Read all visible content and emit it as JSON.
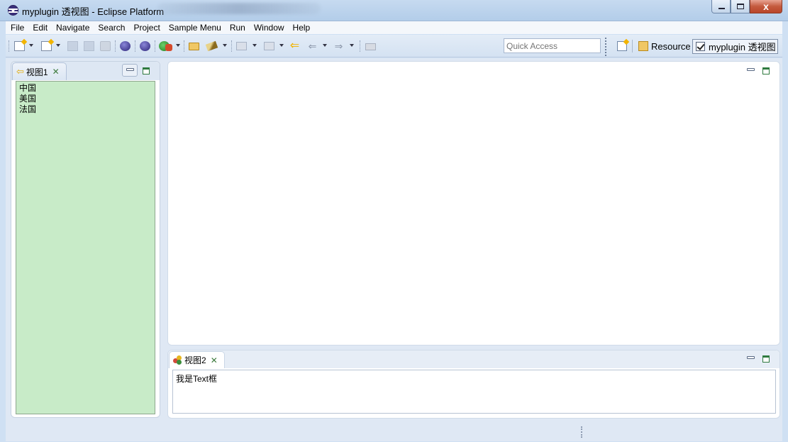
{
  "window": {
    "title": "myplugin 透视图 - Eclipse Platform",
    "buttons": {
      "minimize": "minimize",
      "maximize": "maximize",
      "close": "x"
    }
  },
  "menubar": {
    "items": [
      "File",
      "Edit",
      "Navigate",
      "Search",
      "Project",
      "Sample Menu",
      "Run",
      "Window",
      "Help"
    ]
  },
  "toolbar": {
    "quick_access_placeholder": "Quick Access",
    "perspectives": {
      "resource_label": "Resource",
      "active_label": "myplugin 透视图",
      "active_checked": true
    },
    "icons": [
      "new-icon",
      "new-project-icon",
      "save-icon",
      "save-all-icon",
      "print-icon",
      "web-globe-icon",
      "web-globe-icon-2",
      "run-icon",
      "debug-icon",
      "open-folder-icon",
      "pen-icon",
      "nav-up-icon",
      "nav-down-icon",
      "last-edit-icon",
      "back-icon",
      "forward-icon",
      "pin-editor-icon"
    ]
  },
  "view1": {
    "tab_label": "视图1",
    "tab_icon": "back-arrow-icon",
    "items": [
      "中国",
      "美国",
      "法国"
    ],
    "list_background": "#c8ebc8"
  },
  "view2": {
    "tab_label": "视图2",
    "tab_icon": "gem-icon",
    "text_content": "我是Text框"
  },
  "colors": {
    "workbench_bg": "#dfe8f4",
    "titlebar": "#c6daf0",
    "close_button": "#c45a3e"
  }
}
